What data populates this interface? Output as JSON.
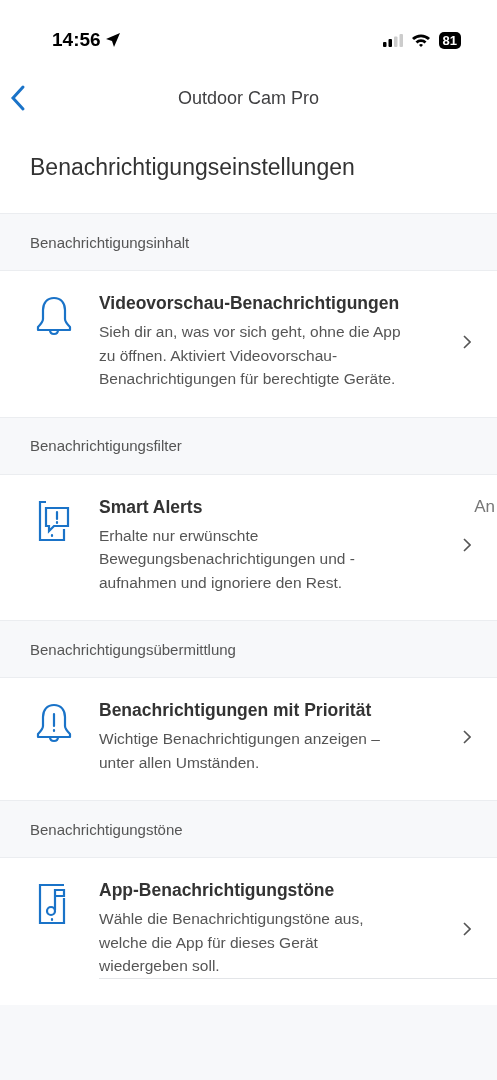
{
  "status_bar": {
    "time": "14:56",
    "battery": "81"
  },
  "nav": {
    "title": "Outdoor Cam Pro"
  },
  "page_title": "Benachrichtigungseinstellungen",
  "sections": [
    {
      "header": "Benachrichtigungsinhalt",
      "items": [
        {
          "kind": "bell",
          "title": "Videovorschau-Benachrichtigungen",
          "description": "Sieh dir an, was vor sich geht, ohne die App zu öffnen. Aktiviert Videovorschau-Benachrichtigungen für berechtigte Geräte."
        }
      ]
    },
    {
      "header": "Benachrichtigungsfilter",
      "items": [
        {
          "kind": "phone-alert",
          "title": "Smart Alerts",
          "value": "An",
          "description": "Erhalte nur erwünschte Bewegungsbenachrichtigungen und -aufnahmen und ignoriere den Rest."
        }
      ]
    },
    {
      "header": "Benachrichtigungsübermittlung",
      "items": [
        {
          "kind": "bell-alert",
          "title": "Benachrichtigungen mit Priorität",
          "description": "Wichtige Benachrichtigungen anzeigen – unter allen Umständen."
        }
      ]
    },
    {
      "header": "Benachrichtigungstöne",
      "items": [
        {
          "kind": "phone-music",
          "title": "App-Benachrichtigungstöne",
          "description": "Wähle die Benachrichtigungstöne aus, welche die App für dieses Gerät wiedergeben soll."
        }
      ]
    }
  ]
}
